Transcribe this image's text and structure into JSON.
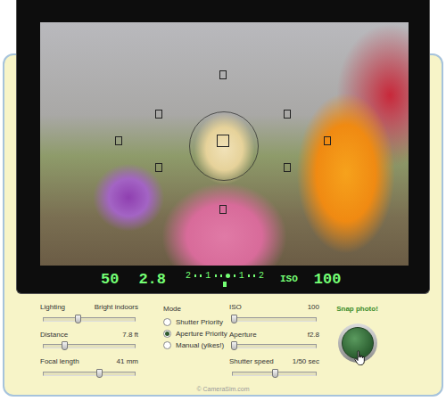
{
  "viewfinder": {
    "readout": {
      "shutter": "50",
      "aperture": "2.8",
      "meter": {
        "labels": [
          "2",
          "1",
          "1",
          "2"
        ],
        "level": 0.5
      },
      "iso_label": "ISO",
      "iso": "100"
    }
  },
  "controls": {
    "left_sliders": [
      {
        "label": "Lighting",
        "value": "Bright indoors",
        "level": 0.38
      },
      {
        "label": "Distance",
        "value": "7.8 ft",
        "level": 0.24
      },
      {
        "label": "Focal length",
        "value": "41 mm",
        "level": 0.62
      }
    ],
    "mode": {
      "title": "Mode",
      "options": [
        {
          "label": "Shutter Priority",
          "selected": false
        },
        {
          "label": "Aperture Priority",
          "selected": true
        },
        {
          "label": "Manual (yikes!)",
          "selected": false
        }
      ]
    },
    "right_sliders": [
      {
        "label": "ISO",
        "value": "100",
        "level": 0.02
      },
      {
        "label": "Aperture",
        "value": "f2.8",
        "level": 0.02
      },
      {
        "label": "Shutter speed",
        "value": "1/50 sec",
        "level": 0.52
      }
    ],
    "snap": {
      "label": "Snap photo!"
    }
  },
  "footer": "© CameraSim.com"
}
